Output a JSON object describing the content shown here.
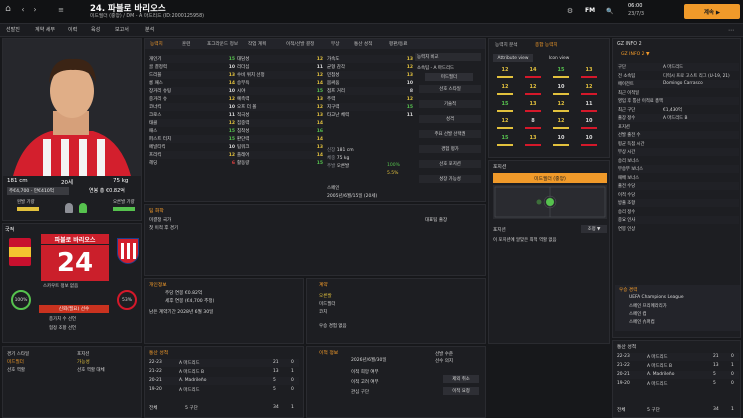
{
  "topbar": {
    "player_title": "24. 파블로 바리오스",
    "subtitle1": "미드필더 (중앙) / DM - A 마드리드 (ID:2000125958)",
    "subtitle2": "미드필더 (중앙) / DM - A 마드리드",
    "fm_label": "FM",
    "time": "06:00",
    "date": "23/7/3",
    "continue_label": "계속 ▶"
  },
  "nav": [
    "선발진",
    "계약 세부",
    "이력",
    "육성",
    "보고서",
    "분석"
  ],
  "tabs_attr": [
    "능력치",
    "훈련",
    "포그라운드 정보",
    "작업 계획",
    "이적/선발 결정",
    "부상",
    "통산 성적",
    "평판/동료"
  ],
  "profile": {
    "height": "181 cm",
    "age": "20세",
    "weight": "75 kg",
    "wage": "주€4,700 - 만€410억",
    "value_label": "연봉 총 €0.82억",
    "foot_left": "왼발 기량",
    "foot_right": "오른발 기량",
    "nation_label": "국적",
    "stars_label": "12"
  },
  "attributes": {
    "col1": [
      [
        "개인기",
        "15"
      ],
      [
        "골 결정력",
        "10"
      ],
      [
        "드리블",
        "13"
      ],
      [
        "롱 패스",
        "14"
      ],
      [
        "장거리 슈팅",
        "10"
      ],
      [
        "중거리 슈",
        "12"
      ],
      [
        "코너킥",
        "10"
      ],
      [
        "크로스",
        "11"
      ],
      [
        "태클",
        "12"
      ],
      [
        "패스",
        "15"
      ],
      [
        "퍼스트 터치",
        "15"
      ],
      [
        "페널티킥",
        "10"
      ],
      [
        "프리킥",
        "12"
      ],
      [
        "헤딩",
        "6"
      ]
    ],
    "col2": [
      [
        "대담성",
        "12"
      ],
      [
        "리더십",
        "11"
      ],
      [
        "수비 위치 선정",
        "12"
      ],
      [
        "승부욕",
        "14"
      ],
      [
        "시야",
        "15"
      ],
      [
        "예측력",
        "13"
      ],
      [
        "오프 더 볼",
        "12"
      ],
      [
        "적극성",
        "13"
      ],
      [
        "집중력",
        "14"
      ],
      [
        "침착성",
        "16"
      ],
      [
        "판단력",
        "14"
      ],
      [
        "팀워크",
        "13"
      ],
      [
        "플레어",
        "14"
      ],
      [
        "활동량",
        "15"
      ]
    ],
    "col3": [
      [
        "가속도",
        "13"
      ],
      [
        "균형 감각",
        "12"
      ],
      [
        "민첩성",
        "13"
      ],
      [
        "몸싸움",
        "10"
      ],
      [
        "점프 거리",
        "8"
      ],
      [
        "주력",
        "12"
      ],
      [
        "지구력",
        "15"
      ],
      [
        "타고난 체력",
        "11"
      ]
    ]
  },
  "side": {
    "ability_label": "능력치 비교",
    "club": "소속팀 - A 마드리드",
    "role": "미드필더",
    "row_labels": [
      "선호 스타일",
      "기술적",
      "성격",
      "주요 선발 선택권",
      "경험 평가",
      "선호 포지션",
      "성장 가능성"
    ]
  },
  "info": {
    "height": "181 cm",
    "weight": "75 kg",
    "foot": "오른발",
    "green_pct": "100%",
    "yel_pct": "5.5%",
    "date": "2005년/6월/15일 (20세)",
    "country": "스페인"
  },
  "chem": {
    "title": "팀 화학",
    "row": "미결정 국가",
    "sub": "첫 이적 후 경기",
    "box_title": "대표팀 출장"
  },
  "pos_panel": {
    "title": "포지션",
    "role_btn": "미드필더 (중앙)",
    "foot_title": "포지션",
    "foot_desc": "이 포지션에 알맞은 최적 역할 없음",
    "foot_btn": "조정 ▼"
  },
  "compare": {
    "tabs": [
      "능력치 분석",
      "종합 능력치"
    ],
    "subtabs": [
      "Attribute view",
      "Icon view"
    ],
    "grid": [
      [
        "12",
        "14",
        "15",
        "13"
      ],
      [
        "12",
        "12",
        "10",
        "12"
      ],
      [
        "15",
        "13",
        "12",
        "11"
      ],
      [
        "12",
        "8",
        "12",
        "10"
      ],
      [
        "15",
        "13",
        "10",
        "10"
      ]
    ]
  },
  "info2": {
    "title": "GZ INFO 2",
    "link": "GZ INFO 2 ▼",
    "rows": [
      [
        "구단",
        "A 마드리드"
      ],
      [
        "전 소속팀",
        "디럭시 프로 고스트 리그 (U-19, 21)"
      ],
      [
        "에이전트",
        "Domingo Carrasco"
      ],
      [
        "최근 이적일",
        ""
      ],
      [
        "영입 후 통산 이적료 총액",
        ""
      ],
      [
        "최근 구단",
        "€1,430억"
      ],
      [
        "출장 정수",
        "A 마드리드 B"
      ],
      [
        "포지션",
        ""
      ],
      [
        "선발 출전 수",
        ""
      ],
      [
        "평균 득점 시간",
        ""
      ],
      [
        "부상 시간",
        ""
      ],
      [
        "승리 보너스",
        ""
      ],
      [
        "무승부 보너스",
        ""
      ],
      [
        "패배 보너스",
        ""
      ],
      [
        "출전 수당",
        ""
      ],
      [
        "이적 수당",
        ""
      ],
      [
        "방출 조항",
        ""
      ],
      [
        "승리 정수",
        ""
      ],
      [
        "중요 인사",
        ""
      ],
      [
        "연봉 인상",
        ""
      ]
    ]
  },
  "trophies": {
    "title": "우승 경력",
    "items": [
      "UEFA Champions League",
      "스페인 프리메라리가",
      "스페인 컵",
      "스페인 슈퍼컵"
    ]
  },
  "player_card": {
    "number": "24",
    "name": "파블로 바리오스",
    "club": "A 마드리드",
    "tag1": "스카우트 정보 없음",
    "tag2": "신뢰(필요) 선수",
    "line1": "종가치 수 선언",
    "line2": "협정 조항 선언",
    "pct_green": "100%",
    "pct_red": "53%"
  },
  "fitness": {
    "title": "개인정보",
    "row1": "주당 연봉 €0.82억",
    "row2": "세후 연봉 (€4,700 추정)",
    "row3": "남은 계약기간 2028년 6월 30일"
  },
  "contract": {
    "title": "계약",
    "label": "오른발",
    "sub1": "미드필더",
    "sub2": "코치",
    "item": "우승 경험 없음"
  },
  "transfer": {
    "title": "이적 정보",
    "left": "선발 수준",
    "right": "선수 의지"
  },
  "career": {
    "title": "통산 성적",
    "rows": [
      [
        "22-23",
        "A 마드리드",
        "21",
        "0"
      ],
      [
        "21-22",
        "A 마드리드 B",
        "13",
        "1"
      ],
      [
        "20-21",
        "A. Madrileño",
        "5",
        "0"
      ],
      [
        "19-20",
        "A 마드리드",
        "5",
        "0"
      ]
    ],
    "total_label": "전체",
    "total_club": "5 구단",
    "total_apps": "34",
    "total_goals": "1"
  },
  "transfer2": {
    "title": "다음 시즌 평가",
    "rows": [
      "2026년/6월/30일",
      "이적 희망 여부",
      "이적 고려 여부",
      "관심 구단"
    ],
    "a": "선발 경기 중",
    "b": "제외 취소",
    "c": "이적 요청"
  },
  "bottom": {
    "l1": "경기 스타일",
    "l2": "포지션",
    "l3": "선호 역할",
    "l4": "선호 역할 대체",
    "v1": "미드필더",
    "v2": "가능성"
  },
  "colors": {
    "accent": "#f59c2a",
    "green": "#56c24e",
    "yellow": "#e2c13d",
    "red": "#d4182a"
  }
}
